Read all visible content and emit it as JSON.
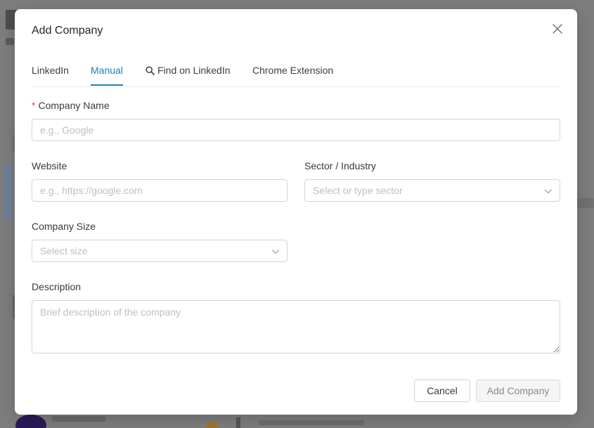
{
  "modal": {
    "title": "Add Company",
    "close_icon": "close-icon"
  },
  "tabs": [
    {
      "label": "LinkedIn",
      "active": false
    },
    {
      "label": "Manual",
      "active": true
    },
    {
      "label": "Find on LinkedIn",
      "active": false,
      "icon": "search-icon"
    },
    {
      "label": "Chrome Extension",
      "active": false
    }
  ],
  "form": {
    "company_name": {
      "label": "Company Name",
      "required_mark": "*",
      "placeholder": "e.g., Google",
      "value": ""
    },
    "website": {
      "label": "Website",
      "placeholder": "e.g., https://google.com",
      "value": ""
    },
    "sector": {
      "label": "Sector / Industry",
      "placeholder": "Select or type sector",
      "value": ""
    },
    "company_size": {
      "label": "Company Size",
      "placeholder": "Select size",
      "value": ""
    },
    "description": {
      "label": "Description",
      "placeholder": "Brief description of the company",
      "value": ""
    }
  },
  "footer": {
    "cancel_label": "Cancel",
    "submit_label": "Add Company"
  },
  "colors": {
    "accent": "#1f7fb3",
    "required": "#e5484d",
    "overlay": "#7d7d7d"
  }
}
